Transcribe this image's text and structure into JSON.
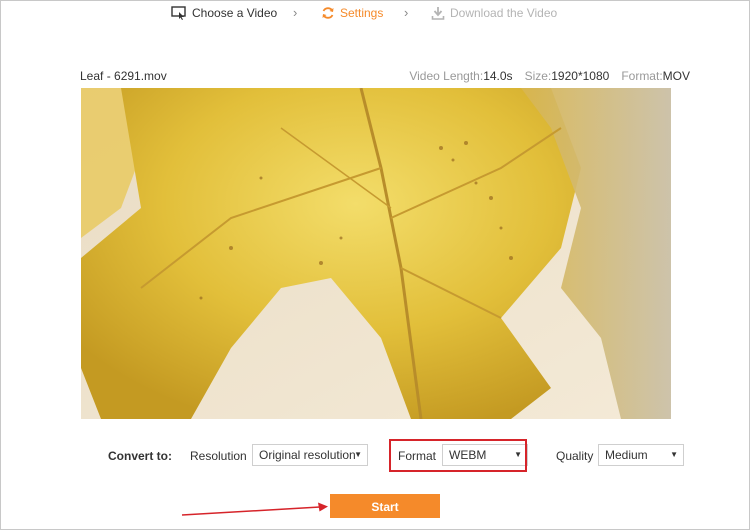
{
  "steps": [
    {
      "label": "Choose a Video",
      "icon": "monitor-cursor-icon"
    },
    {
      "label": "Settings",
      "icon": "refresh-icon"
    },
    {
      "label": "Download the Video",
      "icon": "download-icon"
    }
  ],
  "file": {
    "name": "Leaf - 6291.mov",
    "length_label": "Video Length:",
    "length": "14.0s",
    "size_label": "Size:",
    "size": "1920*1080",
    "format_label": "Format:",
    "format": "MOV"
  },
  "convert": {
    "label": "Convert to:",
    "resolution_label": "Resolution",
    "resolution_value": "Original resolution",
    "format_label": "Format",
    "format_value": "WEBM",
    "quality_label": "Quality",
    "quality_value": "Medium"
  },
  "start_label": "Start",
  "colors": {
    "accent": "#f58a2a",
    "highlight": "#d6242a"
  }
}
